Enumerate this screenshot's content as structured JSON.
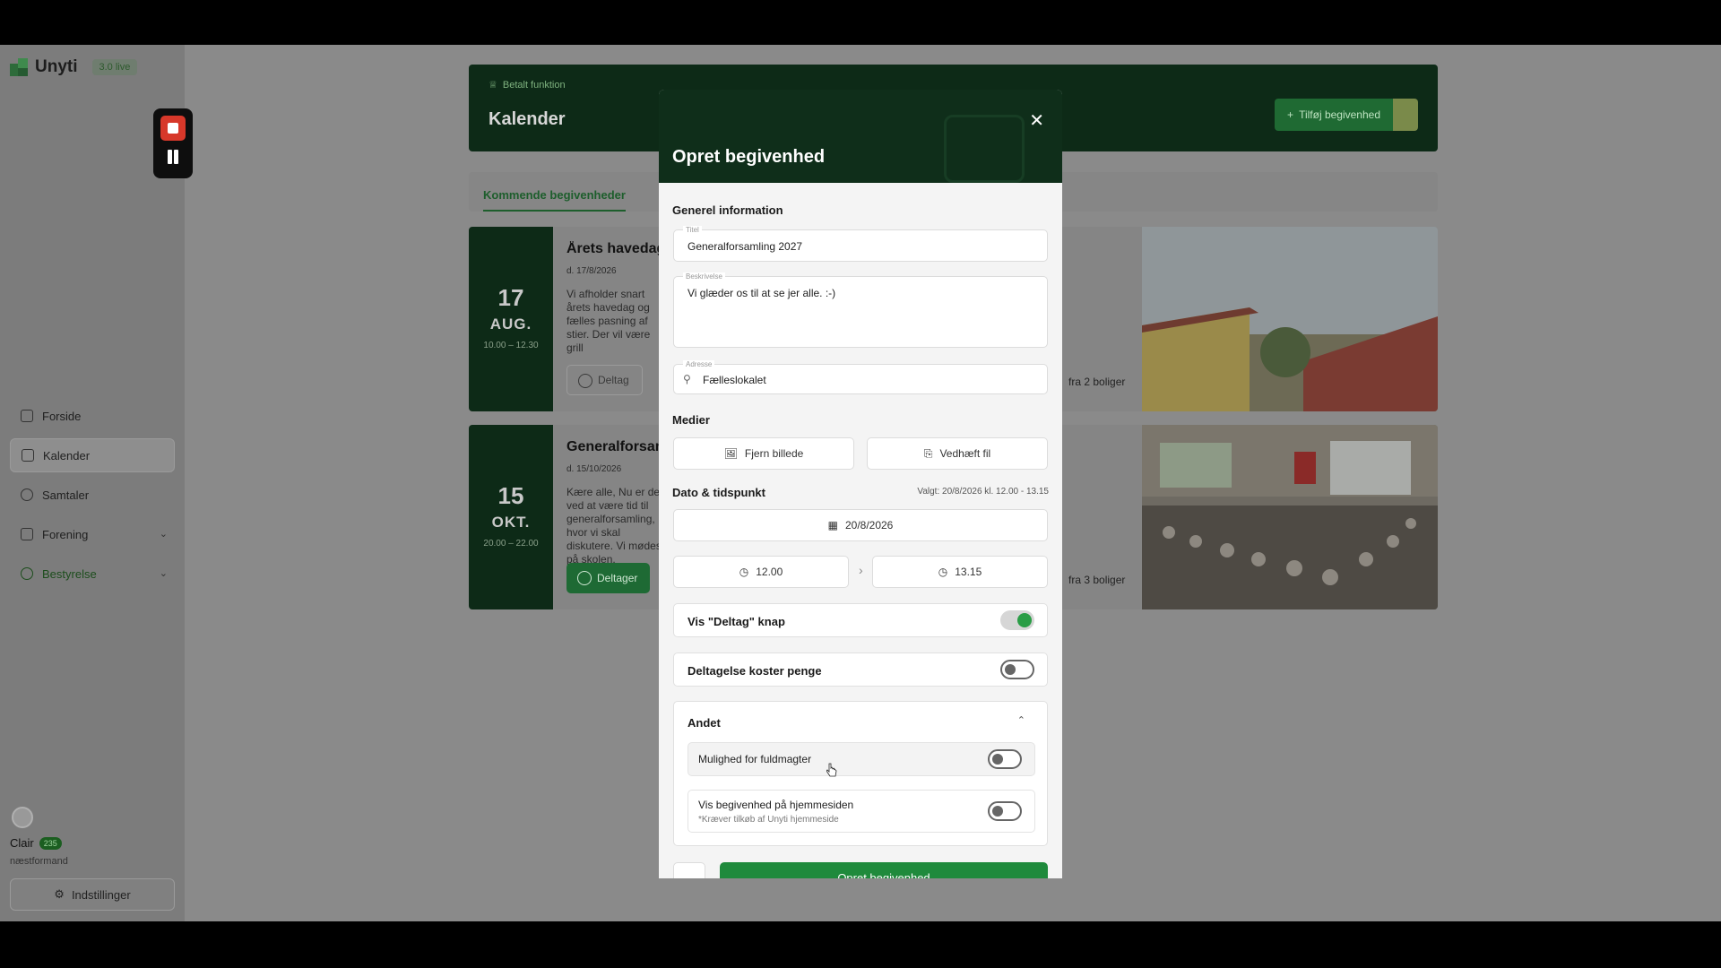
{
  "brand": {
    "name": "Unyti",
    "version": "3.0 live"
  },
  "nav": [
    {
      "label": "Forside",
      "icon": "document-icon"
    },
    {
      "label": "Kalender",
      "icon": "calendar-icon",
      "active": true
    },
    {
      "label": "Samtaler",
      "icon": "chat-icon"
    },
    {
      "label": "Forening",
      "icon": "building-icon",
      "chevron": "⌄"
    },
    {
      "label": "Bestyrelse",
      "icon": "user-icon",
      "chevron": "⌄"
    }
  ],
  "user": {
    "name": "Clair",
    "badge": "235",
    "role": "næstformand",
    "settings_label": "Indstillinger"
  },
  "header": {
    "paid_label": "Betalt funktion",
    "title": "Kalender",
    "add_label": "Tilføj begivenhed"
  },
  "tabs": {
    "active": "Kommende begivenheder"
  },
  "events": [
    {
      "day": "17",
      "month": "AUG.",
      "time": "10.00 – 12.30",
      "title": "Årets havedag",
      "date": "d. 17/8/2026",
      "text": "Vi afholder snart årets havedag og fælles pasning af stier. Der vil være grill",
      "button": "Deltag",
      "homes": "fra 2 boliger"
    },
    {
      "day": "15",
      "month": "OKT.",
      "time": "20.00 – 22.00",
      "title": "Generalforsamling",
      "date": "d. 15/10/2026",
      "text": "Kære alle, Nu er det ved at være tid til generalforsamling, hvor vi skal diskutere. Vi mødes på skolen.",
      "button": "Deltager",
      "homes": "fra 3 boliger"
    }
  ],
  "modal": {
    "title": "Opret begivenhed",
    "close": "✕",
    "general_section": "Generel information",
    "title_label": "Titel",
    "title_value": "Generalforsamling 2027",
    "desc_label": "Beskrivelse",
    "desc_value": "Vi glæder os til at se jer alle. :-)",
    "address_label": "Adresse",
    "address_value": "Fælleslokalet",
    "media_section": "Medier",
    "remove_image": "Fjern billede",
    "attach_file": "Vedhæft fil",
    "datetime_section": "Dato & tidspunkt",
    "chosen": "Valgt: 20/8/2026 kl. 12.00 - 13.15",
    "date_value": "20/8/2026",
    "start_time": "12.00",
    "end_time": "13.15",
    "arrow": "›",
    "toggle_deltag": "Vis \"Deltag\" knap",
    "toggle_cost": "Deltagelse koster penge",
    "other_section": "Andet",
    "other_chevron": "⌃",
    "proxy_label": "Mulighed for fuldmagter",
    "website_label": "Vis begivenhed på hjemmesiden",
    "website_note": "*Kræver tilkøb af Unyti hjemmeside",
    "create_label": "Opret begivenhed"
  },
  "colors": {
    "brand_green": "#1f8a3c",
    "dark_green": "#0f2e1a",
    "toggle_on": "#2a9d46"
  }
}
